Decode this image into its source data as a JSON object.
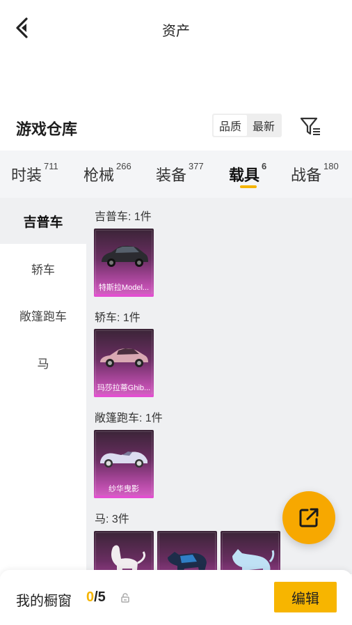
{
  "header": {
    "title": "资产"
  },
  "section": {
    "title": "游戏仓库",
    "sort_options": [
      "品质",
      "最新"
    ],
    "active_sort": "品质"
  },
  "tabs": [
    {
      "label": "时装",
      "count": "711"
    },
    {
      "label": "枪械",
      "count": "266"
    },
    {
      "label": "装备",
      "count": "377"
    },
    {
      "label": "载具",
      "count": "6",
      "active": true
    },
    {
      "label": "战备",
      "count": "180"
    }
  ],
  "sidebar": {
    "items": [
      {
        "label": "吉普车",
        "active": true
      },
      {
        "label": "轿车"
      },
      {
        "label": "敞篷跑车"
      },
      {
        "label": "马"
      }
    ]
  },
  "groups": [
    {
      "label": "吉普车: 1件",
      "items": [
        {
          "name": "特斯拉Model...",
          "icon": "suv-icon"
        }
      ]
    },
    {
      "label": "轿车: 1件",
      "items": [
        {
          "name": "玛莎拉蒂Ghib...",
          "icon": "sedan-icon"
        }
      ]
    },
    {
      "label": "敞篷跑车: 1件",
      "items": [
        {
          "name": "纱华曳影",
          "icon": "roadster-icon"
        }
      ]
    },
    {
      "label": "马: 3件",
      "items": [
        {
          "name": "",
          "icon": "white-horse-icon"
        },
        {
          "name": "",
          "icon": "armored-wolf-icon"
        },
        {
          "name": "",
          "icon": "ice-wolf-icon"
        }
      ]
    }
  ],
  "footer": {
    "showcase_label": "我的橱窗",
    "current": "0",
    "total": "/5",
    "edit_label": "编辑"
  },
  "colors": {
    "accent": "#f7b500",
    "card_gradient_bottom": "#d566c4",
    "panel_bg": "#eff0f2"
  }
}
